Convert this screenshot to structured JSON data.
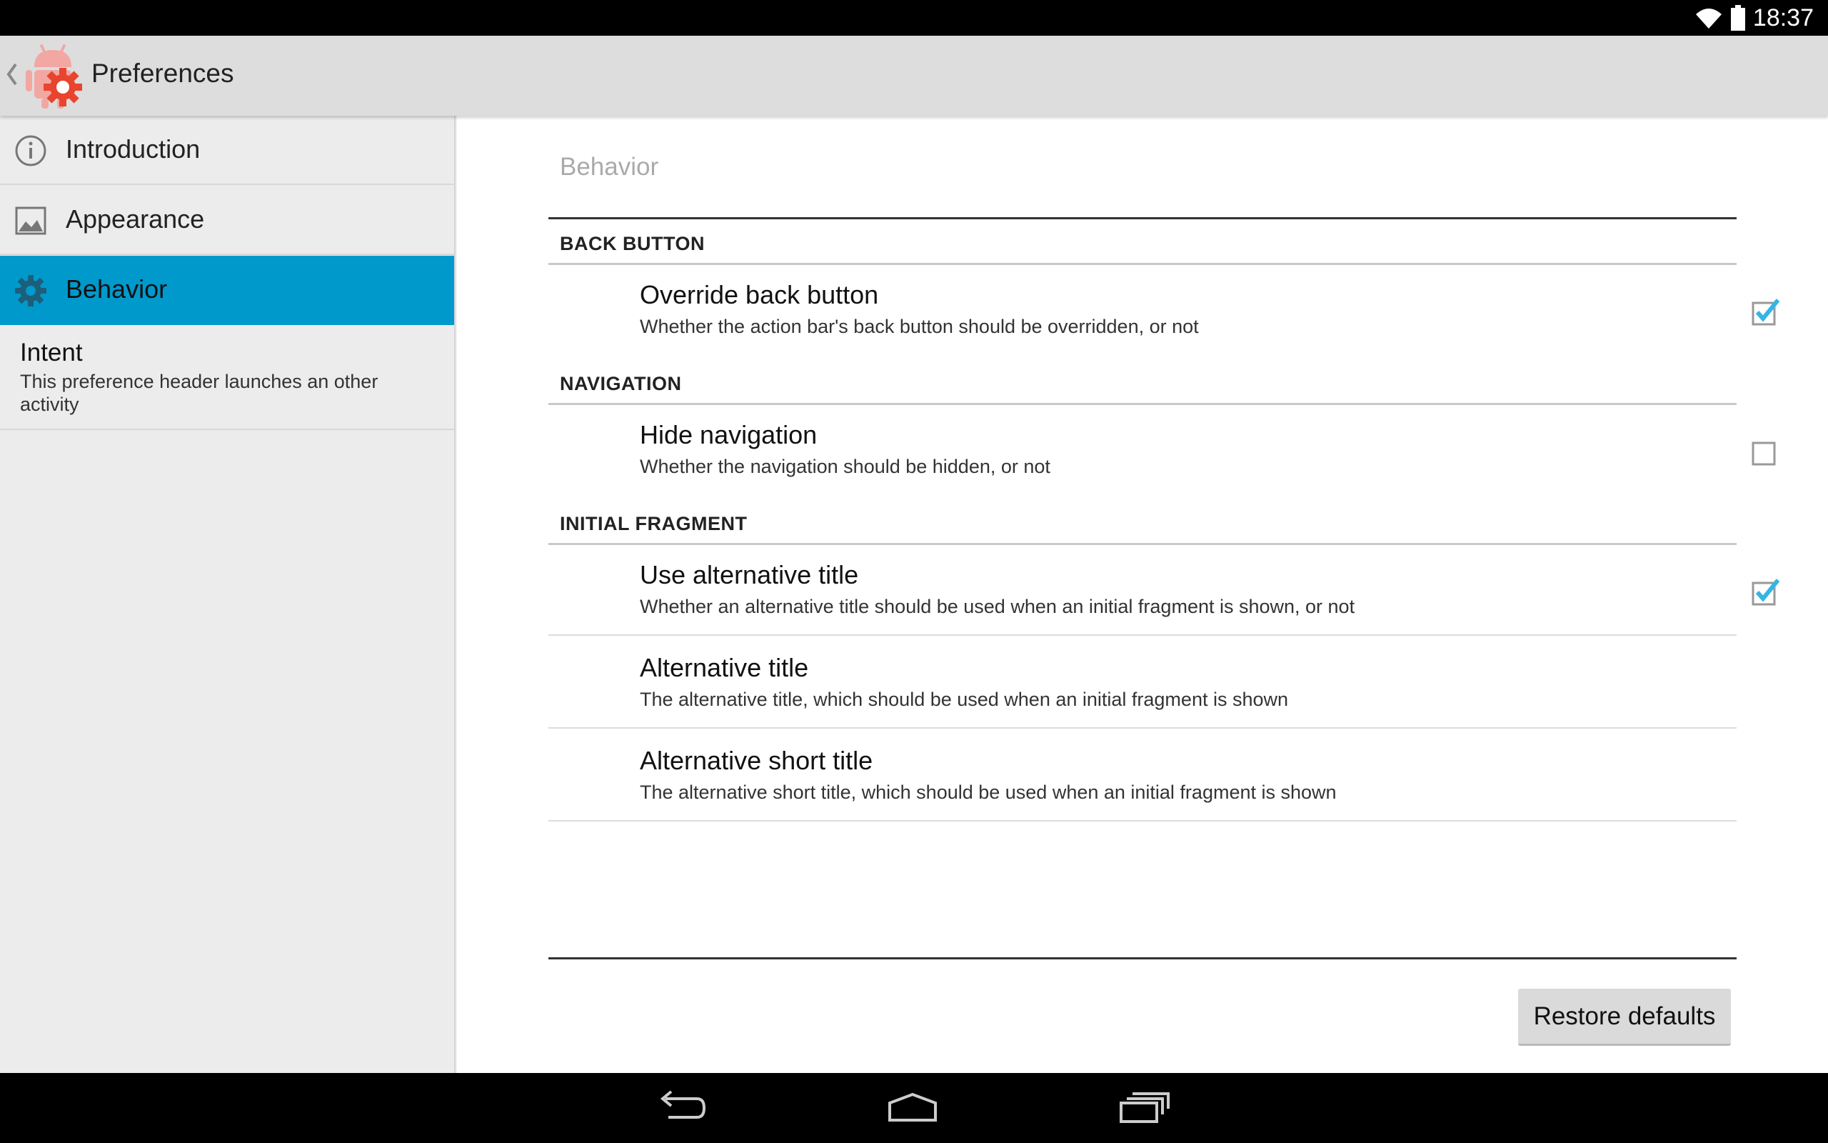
{
  "status_bar": {
    "time": "18:37"
  },
  "action_bar": {
    "title": "Preferences"
  },
  "sidebar": {
    "items": [
      {
        "label": "Introduction",
        "icon": "info-icon"
      },
      {
        "label": "Appearance",
        "icon": "image-icon"
      },
      {
        "label": "Behavior",
        "icon": "gear-icon",
        "selected": true
      }
    ],
    "intent": {
      "title": "Intent",
      "summary": "This preference header launches an other activity"
    }
  },
  "main": {
    "breadcrumb": "Behavior",
    "categories": [
      {
        "title": "BACK BUTTON",
        "prefs": [
          {
            "title": "Override back button",
            "summary": "Whether the action bar's back button should be overridden, or not",
            "checked": true
          }
        ]
      },
      {
        "title": "NAVIGATION",
        "prefs": [
          {
            "title": "Hide navigation",
            "summary": "Whether the navigation should be hidden, or not",
            "checked": false
          }
        ]
      },
      {
        "title": "INITIAL FRAGMENT",
        "prefs": [
          {
            "title": "Use alternative title",
            "summary": "Whether an alternative title should be used when an initial fragment is shown, or not",
            "checked": true
          },
          {
            "title": "Alternative title",
            "summary": "The alternative title, which should be used when an initial fragment is shown"
          },
          {
            "title": "Alternative short title",
            "summary": "The alternative short title, which should be used when an initial fragment is shown"
          }
        ]
      }
    ],
    "restore_button": "Restore defaults"
  },
  "colors": {
    "accent": "#0099cc",
    "checkmark": "#33b5e5",
    "action_bar": "#dddddd",
    "sidebar": "#ececec"
  }
}
